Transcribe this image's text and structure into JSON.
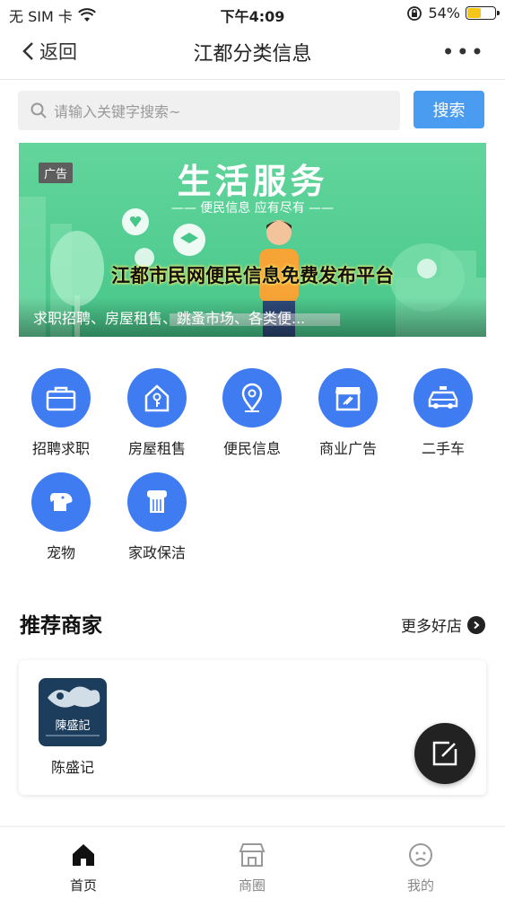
{
  "status_bar": {
    "carrier": "无 SIM 卡",
    "time": "下午4:09",
    "battery": "54%",
    "battery_level": 0.54
  },
  "nav": {
    "back_label": "返回",
    "title": "江都分类信息",
    "more_label": "•••"
  },
  "search": {
    "placeholder": "请输入关键字搜索~",
    "button": "搜索"
  },
  "banner": {
    "ad_tag": "广告",
    "heading": "生活服务",
    "subheading": "—— 便民信息 应有尽有 ——",
    "overlay_text": "江都市民网便民信息免费发布平台",
    "caption": "求职招聘、房屋租售、跳蚤市场、各类便..."
  },
  "categories": [
    {
      "label": "招聘求职",
      "icon": "briefcase-icon"
    },
    {
      "label": "房屋租售",
      "icon": "house-key-icon"
    },
    {
      "label": "便民信息",
      "icon": "location-pin-icon"
    },
    {
      "label": "商业广告",
      "icon": "storefront-icon"
    },
    {
      "label": "二手车",
      "icon": "taxi-icon"
    },
    {
      "label": "宠物",
      "icon": "dog-icon"
    },
    {
      "label": "家政保洁",
      "icon": "cleaning-icon"
    }
  ],
  "merchants_section": {
    "title": "推荐商家",
    "more_label": "更多好店",
    "items": [
      {
        "name": "陈盛记",
        "logo_text": "陳盛記"
      }
    ]
  },
  "fab": {
    "icon": "edit-icon"
  },
  "tabbar": [
    {
      "label": "首页",
      "icon": "home-icon",
      "active": true
    },
    {
      "label": "商圈",
      "icon": "shop-icon",
      "active": false
    },
    {
      "label": "我的",
      "icon": "user-face-icon",
      "active": false
    }
  ],
  "colors": {
    "accent": "#3f7cf2",
    "search_button": "#4a9cf0",
    "banner_green": "#55cd92",
    "battery": "#f5c518"
  }
}
